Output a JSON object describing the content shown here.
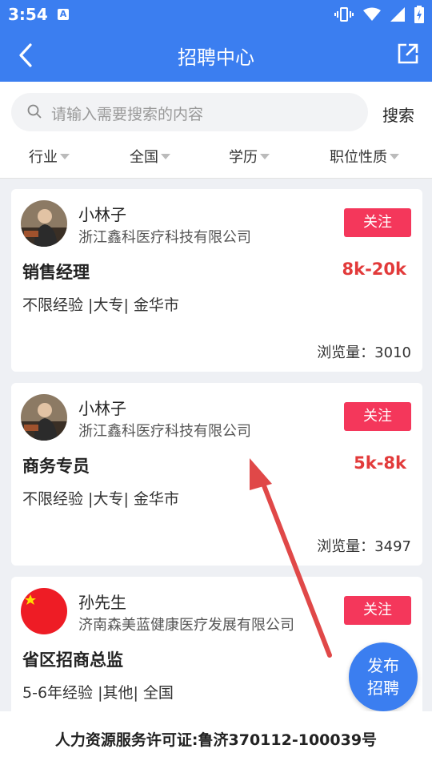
{
  "status": {
    "time": "3:54",
    "sim_label": "A"
  },
  "nav": {
    "title": "招聘中心"
  },
  "search": {
    "placeholder": "请输入需要搜索的内容",
    "button": "搜索"
  },
  "filters": [
    "行业",
    "全国",
    "学历",
    "职位性质"
  ],
  "jobs": [
    {
      "name": "小林子",
      "company": "浙江鑫科医疗科技有限公司",
      "follow": "关注",
      "title": "销售经理",
      "salary": "8k-20k",
      "requirements": "不限经验 |大专| 金华市",
      "views": "浏览量：3010"
    },
    {
      "name": "小林子",
      "company": "浙江鑫科医疗科技有限公司",
      "follow": "关注",
      "title": "商务专员",
      "salary": "5k-8k",
      "requirements": "不限经验 |大专| 金华市",
      "views": "浏览量：3497"
    },
    {
      "name": "孙先生",
      "company": "济南森美蓝健康医疗发展有限公司",
      "follow": "关注",
      "title": "省区招商总监",
      "salary": "",
      "requirements": "5-6年经验 |其他| 全国",
      "views": ""
    }
  ],
  "fab": {
    "line1": "发布",
    "line2": "招聘"
  },
  "footer": {
    "license": "人力资源服务许可证:鲁济370112-100039号"
  },
  "colors": {
    "primary": "#3b7ef0",
    "follow": "#f4375b",
    "salary": "#e23a3a",
    "annotation_arrow": "#e04848"
  }
}
